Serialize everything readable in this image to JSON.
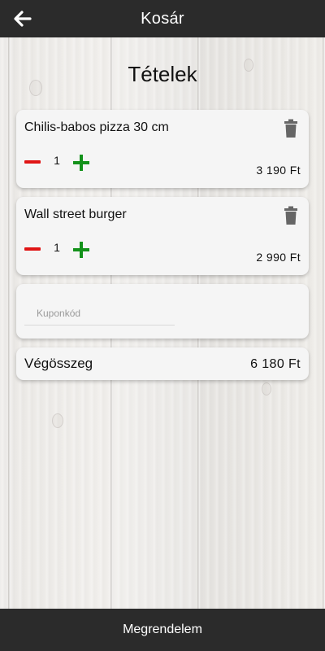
{
  "header": {
    "title": "Kosár",
    "back_icon": "arrow-left-icon"
  },
  "section": {
    "title": "Tételek"
  },
  "cart": {
    "items": [
      {
        "name": "Chilis-babos pizza 30 cm",
        "quantity": "1",
        "price": "3 190 Ft"
      },
      {
        "name": "Wall street burger",
        "quantity": "1",
        "price": "2 990 Ft"
      }
    ]
  },
  "coupon": {
    "placeholder": "Kuponkód",
    "value": ""
  },
  "total": {
    "label": "Végösszeg",
    "value": "6 180 Ft"
  },
  "footer": {
    "order_label": "Megrendelem"
  },
  "colors": {
    "bar_background": "#2b2b2b",
    "minus": "#e01515",
    "plus": "#13921a",
    "card": "#f5f5f5"
  }
}
